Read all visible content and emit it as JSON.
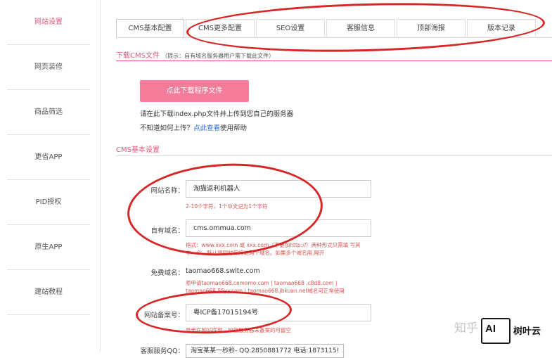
{
  "sidebar": {
    "items": [
      {
        "label": "网站设置",
        "active": true
      },
      {
        "label": "网页装修"
      },
      {
        "label": "商品筛选"
      },
      {
        "label": "更省APP"
      },
      {
        "label": "PID授权"
      },
      {
        "label": "原生APP"
      },
      {
        "label": "建站教程"
      }
    ]
  },
  "tabs": [
    {
      "label": "CMS基本配置",
      "active": true
    },
    {
      "label": "CMS更多配置"
    },
    {
      "label": "SEO设置"
    },
    {
      "label": "客服信息"
    },
    {
      "label": "顶部海报"
    },
    {
      "label": "版本记录"
    }
  ],
  "download": {
    "section_title": "下载CMS文件",
    "hint": "（提示：自有域名服务器用户需下载此文件）",
    "button_label": "点此下载程序文件",
    "instruction": "请在此下载index.php文件并上传到您自己的服务器",
    "help_prefix": "不知道如何上传？",
    "help_link": "点此查看",
    "help_suffix": "使用帮助"
  },
  "basic": {
    "section_title": "CMS基本设置",
    "site_name_label": "网站名称：",
    "site_name_value": "淘猫返利机器人",
    "site_name_help": "2-10个字符，1个中文记为1个字符",
    "domain_label": "自有域名：",
    "domain_value": "cms.ommua.com",
    "domain_help_1": "格式：www.xxx.com 或 xxx.com（不要加http://）两种形式只需填 写其",
    "domain_help_2": "中一个，默认将同时保持这两个域名。如果多个域名用,隔开",
    "free_domain_label": "免费域名：",
    "free_domain_value": "taomao668.swlte.com",
    "free_domain_help_1": "原申请taomao668.cemomo.com | taomao668 .c8d8.com |",
    "free_domain_help_2": "taomao668.55yy.com | taomao668.jbkuan.net域名可正常使用",
    "icp_label": "网站备案号：",
    "icp_value": "粤ICP备17015194号",
    "icp_help": "显示在网站底部，如您服务器未备案的可留空",
    "qq_label": "客服服务QQ：",
    "qq_value": "淘宝某某一秒秒- QQ:2850881772 电话:1873115!"
  },
  "watermark": {
    "text": "知乎"
  },
  "logo": {
    "mark": "AI",
    "text": "树叶云"
  },
  "colors": {
    "accent": "#e8587e",
    "button": "#f47c9a",
    "annotation": "#d62626",
    "link": "#2a6dd8"
  }
}
